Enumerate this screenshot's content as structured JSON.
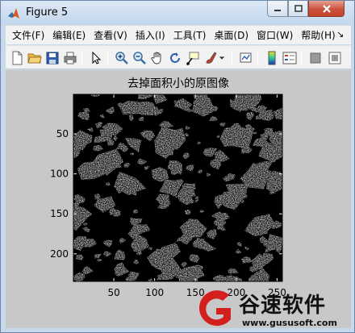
{
  "window": {
    "title": "Figure 5",
    "controls": [
      "minimize",
      "maximize",
      "close"
    ]
  },
  "menubar": {
    "items": [
      "文件(F)",
      "编辑(E)",
      "查看(V)",
      "插入(I)",
      "工具(T)",
      "桌面(D)",
      "窗口(W)",
      "帮助(H)"
    ],
    "overflow_glyph": "↘"
  },
  "toolbar": {
    "icons": [
      "new-figure-icon",
      "open-file-icon",
      "save-icon",
      "print-icon",
      "edit-plot-arrow-icon",
      "zoom-in-icon",
      "zoom-out-icon",
      "pan-hand-icon",
      "rotate-3d-icon",
      "data-cursor-icon",
      "brush-icon",
      "link-plot-icon",
      "colorbar-icon",
      "legend-icon",
      "hide-plot-tools-icon",
      "show-plot-tools-icon"
    ]
  },
  "figure": {
    "axes_title": "去掉面积小的原图像",
    "x_ticks": [
      "50",
      "100",
      "150",
      "200",
      "250"
    ],
    "y_ticks": [
      "50",
      "100",
      "150",
      "200"
    ],
    "x_range": [
      0.5,
      256.5
    ],
    "y_range": [
      0.5,
      234.5
    ],
    "image": "binary-grayscale-particles"
  },
  "watermark": {
    "text": "谷速软件",
    "url": "www.gususoft.com"
  }
}
